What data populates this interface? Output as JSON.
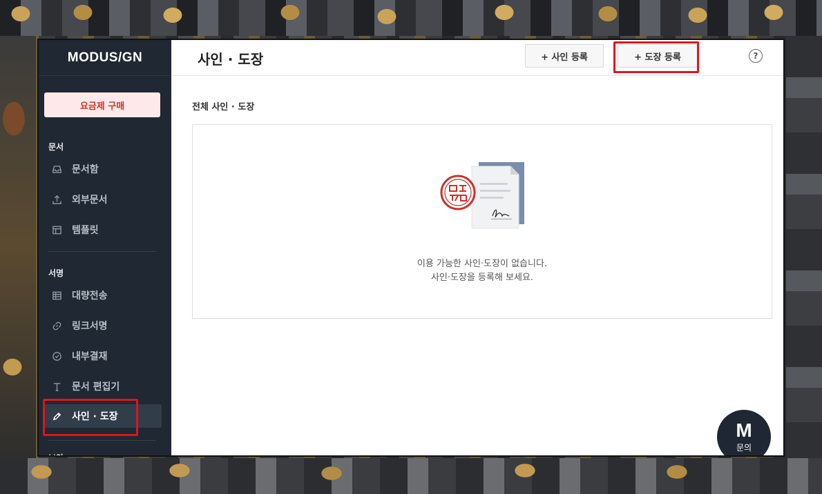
{
  "sidebar": {
    "logo": "MODUS/GN",
    "plan_button": "요금제 구매",
    "sections": [
      {
        "label": "문서",
        "items": [
          {
            "label": "문서함",
            "icon": "inbox-icon"
          },
          {
            "label": "외부문서",
            "icon": "upload-icon"
          },
          {
            "label": "템플릿",
            "icon": "template-icon"
          }
        ]
      },
      {
        "label": "서명",
        "items": [
          {
            "label": "대량전송",
            "icon": "table-icon"
          },
          {
            "label": "링크서명",
            "icon": "link-icon"
          },
          {
            "label": "내부결재",
            "icon": "check-circle-icon"
          },
          {
            "label": "문서 편집기",
            "icon": "text-icon"
          },
          {
            "label": "사인 · 도장",
            "icon": "pen-icon",
            "active": true
          }
        ]
      }
    ],
    "next_section_label": "보안"
  },
  "header": {
    "title": "사인 · 도장",
    "sign_button": "+ 사인 등록",
    "stamp_button": "+ 도장 등록",
    "help": "?"
  },
  "main": {
    "section_title": "전체 사인 · 도장",
    "empty_line1": "이용 가능한 사인·도장이 없습니다.",
    "empty_line2": "사인·도장을 등록해 보세요."
  },
  "chat": {
    "logo_letter": "M",
    "label": "문의"
  },
  "colors": {
    "sidebar_bg": "#1f2833",
    "accent_red": "#e0141e",
    "plan_bg": "#fde9e9"
  }
}
